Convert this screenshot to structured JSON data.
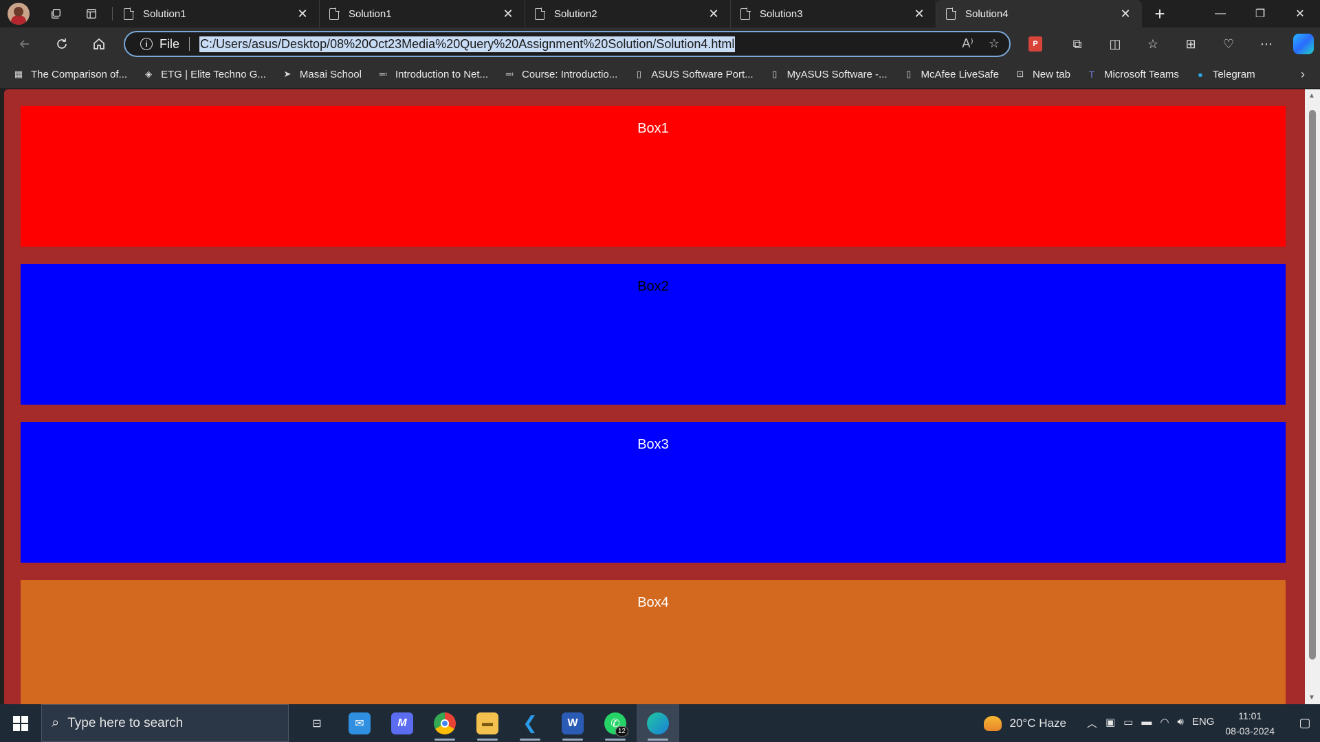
{
  "browser": {
    "tabs": [
      {
        "title": "Solution1",
        "active": false
      },
      {
        "title": "Solution1",
        "active": false
      },
      {
        "title": "Solution2",
        "active": false
      },
      {
        "title": "Solution3",
        "active": false
      },
      {
        "title": "Solution4",
        "active": true
      }
    ],
    "close_glyph": "✕",
    "new_tab_glyph": "+",
    "window_controls": {
      "minimize": "—",
      "restore": "❐",
      "close": "✕"
    },
    "address": {
      "scheme_label": "File",
      "url": "C:/Users/asus/Desktop/08%20Oct23Media%20Query%20Assignment%20Solution/Solution4.html"
    },
    "bookmarks": [
      {
        "label": "The Comparison of...",
        "icon": "dcu-icon"
      },
      {
        "label": "ETG | Elite Techno G...",
        "icon": "etg-icon"
      },
      {
        "label": "Masai School",
        "icon": "masai-icon"
      },
      {
        "label": "Introduction to Net...",
        "icon": "course-icon"
      },
      {
        "label": "Course: Introductio...",
        "icon": "course-icon"
      },
      {
        "label": "ASUS Software Port...",
        "icon": "page-icon"
      },
      {
        "label": "MyASUS Software -...",
        "icon": "page-icon"
      },
      {
        "label": "McAfee LiveSafe",
        "icon": "page-icon"
      },
      {
        "label": "New tab",
        "icon": "newtab-icon"
      },
      {
        "label": "Microsoft Teams",
        "icon": "teams-icon"
      },
      {
        "label": "Telegram",
        "icon": "telegram-icon"
      }
    ]
  },
  "page": {
    "background": "#a52a2a",
    "boxes": [
      {
        "label": "Box1",
        "color": "#ff0000",
        "text_color": "#ffffff"
      },
      {
        "label": "Box2",
        "color": "#0000ff",
        "text_color": "#000000"
      },
      {
        "label": "Box3",
        "color": "#0000ff",
        "text_color": "#ffffff"
      },
      {
        "label": "Box4",
        "color": "#d2691e",
        "text_color": "#ffffff"
      }
    ]
  },
  "taskbar": {
    "search_placeholder": "Type here to search",
    "apps": [
      "task-view-icon",
      "mail-icon",
      "visual-studio-icon",
      "chrome-icon",
      "file-explorer-icon",
      "vscode-icon",
      "word-icon",
      "whatsapp-icon",
      "edge-icon"
    ],
    "whatsapp_badge": "12",
    "weather": "20°C  Haze",
    "language": "ENG",
    "time": "11:01",
    "date": "08-03-2024"
  }
}
